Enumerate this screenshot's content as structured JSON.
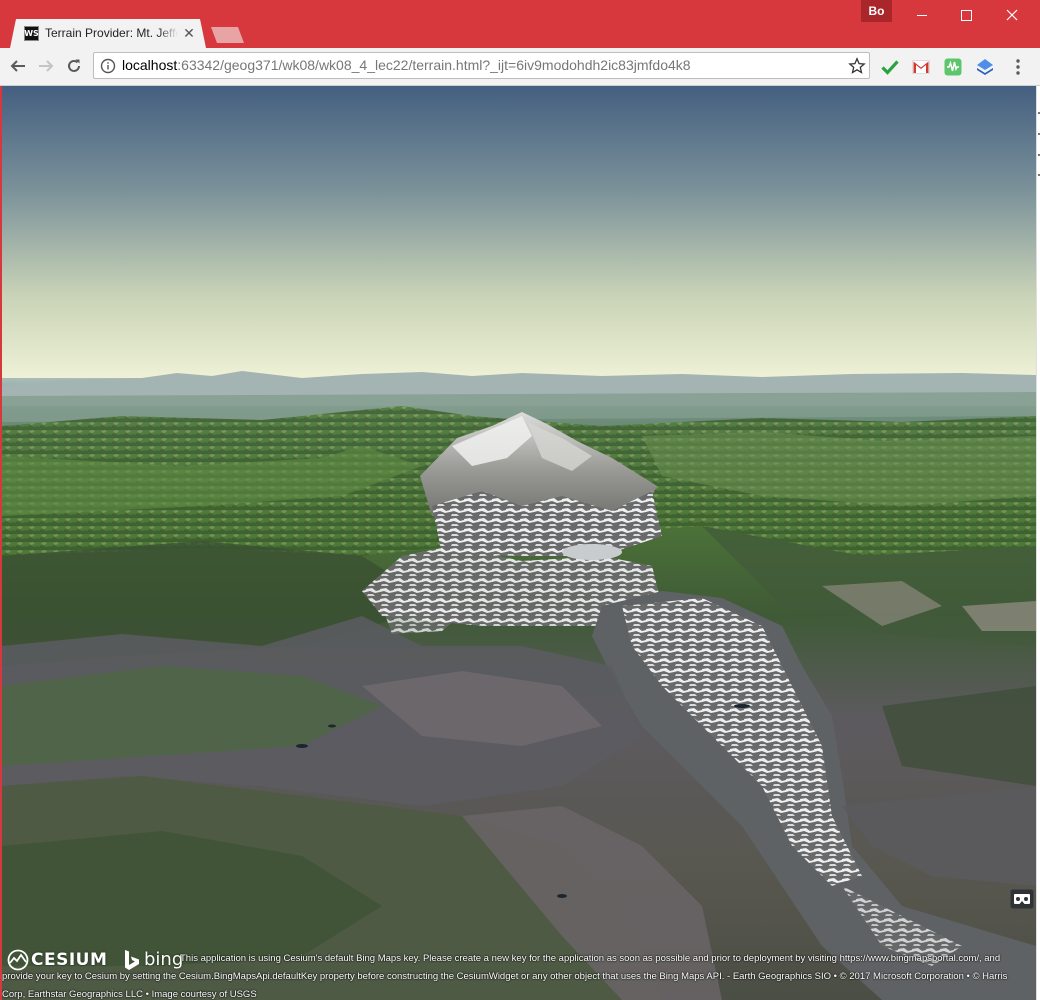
{
  "browser": {
    "tab": {
      "favicon_text": "WS",
      "title": "Terrain Provider: Mt. Jefferson"
    },
    "profile_label": "Bo",
    "address_bar": {
      "url_host": "localhost",
      "url_rest": ":63342/geog371/wk08/wk08_4_lec22/terrain.html?_ijt=6iv9modohdh2ic83jmfdo4k8"
    },
    "extensions": [
      "check-icon",
      "gmail-icon",
      "green-extension-icon",
      "blue-extension-icon"
    ],
    "colors": {
      "frame": "#d6383d",
      "toolbar": "#f2f2f2"
    }
  },
  "viewer": {
    "logos": {
      "cesium": "CESIUM",
      "bing": "bing"
    },
    "credit_text": "This application is using Cesium's default Bing Maps key. Please create a new key for the application as soon as possible and prior to deployment by visiting https://www.bingmapsportal.com/, and provide your key to Cesium by setting the Cesium.BingMapsApi.defaultKey property before constructing the CesiumWidget or any other object that uses the Bing Maps API. - Earth Geographics SIO • © 2017 Microsoft Corporation • © Harris Corp, Earthstar Geographics LLC • Image courtesy of USGS",
    "vr_button_icon": "vr-headset-icon",
    "colors": {
      "sky_top": "#445f80",
      "horizon": "#f2f4d8",
      "forest": "#4d7438",
      "snow": "#eef0f2",
      "rock": "#6f6a6e"
    }
  }
}
